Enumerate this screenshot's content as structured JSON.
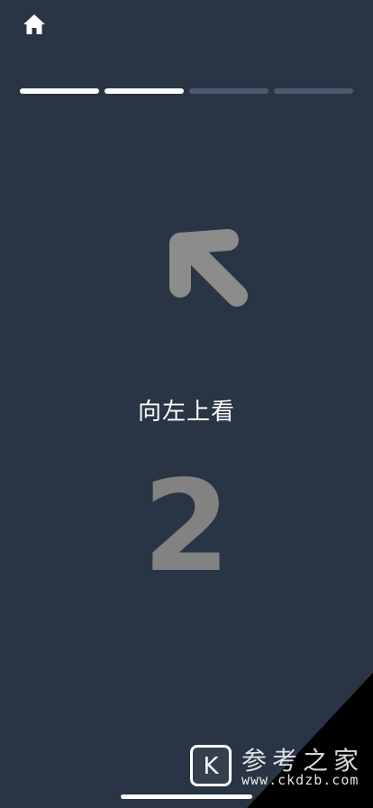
{
  "icons": {
    "home": "home-icon",
    "direction": "arrow-up-left-icon"
  },
  "progress": {
    "completed_steps": 2,
    "total_steps": 4
  },
  "instruction": {
    "text": "向左上看"
  },
  "countdown": {
    "value": "2"
  },
  "watermark": {
    "logo_letter": "K",
    "site_name": "参考之家",
    "url": "www.ckdzb.com"
  },
  "colors": {
    "background": "#293544",
    "progress_done": "#ffffff",
    "progress_pending": "#4a5a70",
    "arrow": "#8c8c8c",
    "countdown": "#828282"
  }
}
